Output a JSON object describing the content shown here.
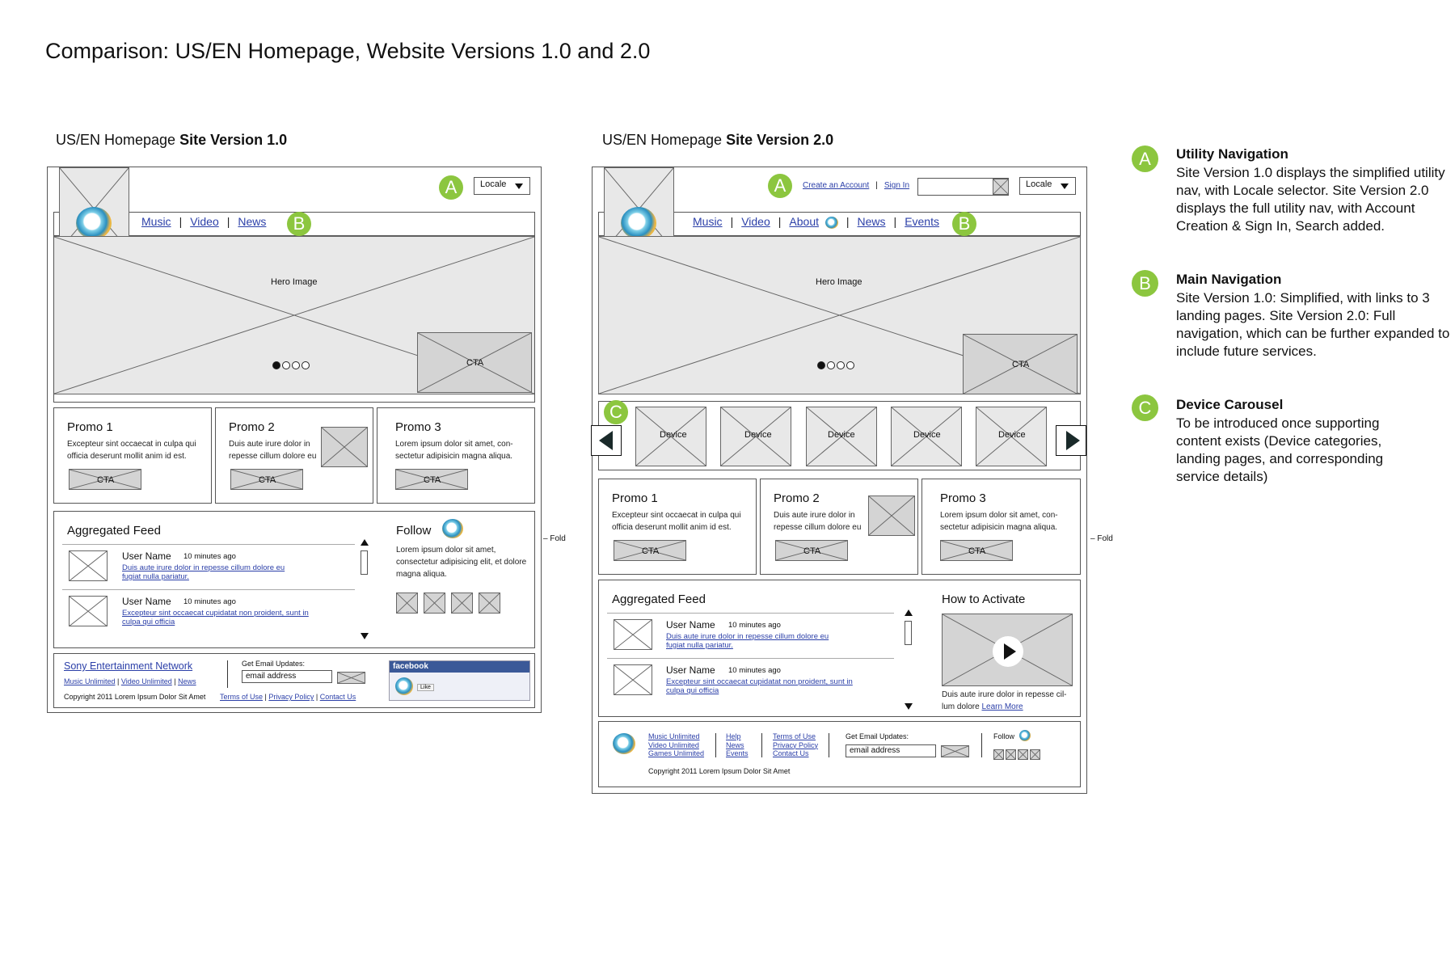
{
  "title": "Comparison: US/EN Homepage, Website Versions 1.0 and 2.0",
  "v1": {
    "label_prefix": "US/EN Homepage ",
    "label_bold": "Site Version 1.0",
    "locale": "Locale",
    "nav": [
      "Music",
      "Video",
      "News"
    ],
    "hero": "Hero Image",
    "cta": "CTA",
    "promos": [
      {
        "title": "Promo 1",
        "text": "Excepteur sint occaecat in culpa qui officia deserunt mollit anim id est."
      },
      {
        "title": "Promo 2",
        "text": "Duis aute irure dolor in repesse cillum dolore eu"
      },
      {
        "title": "Promo 3",
        "text": "Lorem ipsum dolor sit amet, con-sectetur adipisicin magna aliqua."
      }
    ],
    "feed_title": "Aggregated Feed",
    "feed_items": [
      {
        "user": "User Name",
        "time": "10 minutes ago",
        "text": "Duis aute irure dolor in repesse cillum dolore eu fugiat nulla pariatur."
      },
      {
        "user": "User Name",
        "time": "10 minutes ago",
        "text": "Excepteur sint occaecat cupidatat non proident, sunt in culpa qui officia"
      }
    ],
    "follow_title": "Follow",
    "follow_text": "Lorem ipsum dolor sit amet, consectetur adipisicing elit, et dolore magna aliqua.",
    "fold": "Fold",
    "footer": {
      "brand": "Sony Entertainment Network",
      "links": [
        "Music Unlimited",
        "Video Unlimited",
        "News"
      ],
      "copyright": "Copyright 2011 Lorem Ipsum Dolor Sit Amet",
      "legal": [
        "Terms of Use",
        "Privacy Policy",
        "Contact Us"
      ],
      "email_label": "Get Email Updates:",
      "email_placeholder": "email address",
      "facebook": "facebook",
      "like": "Like"
    }
  },
  "v2": {
    "label_prefix": "US/EN Homepage ",
    "label_bold": "Site Version 2.0",
    "create_account": "Create an Account",
    "sign_in": "Sign In",
    "locale": "Locale",
    "nav": [
      "Music",
      "Video",
      "About",
      "News",
      "Events"
    ],
    "hero": "Hero Image",
    "cta": "CTA",
    "devices": [
      "Device",
      "Device",
      "Device",
      "Device",
      "Device"
    ],
    "promos": [
      {
        "title": "Promo 1",
        "text": "Excepteur sint occaecat in culpa qui officia deserunt mollit anim id est."
      },
      {
        "title": "Promo 2",
        "text": "Duis aute irure dolor in repesse cillum dolore eu"
      },
      {
        "title": "Promo 3",
        "text": "Lorem ipsum dolor sit amet, con-sectetur adipisicin magna aliqua."
      }
    ],
    "feed_title": "Aggregated Feed",
    "feed_items": [
      {
        "user": "User Name",
        "time": "10 minutes ago",
        "text": "Duis aute irure dolor in repesse cillum dolore eu fugiat nulla pariatur."
      },
      {
        "user": "User Name",
        "time": "10 minutes ago",
        "text": "Excepteur sint occaecat cupidatat non proident, sunt in culpa qui officia"
      }
    ],
    "activate_title": "How to Activate",
    "activate_text": "Duis aute irure dolor in repesse cil-lum dolore",
    "learn_more": "Learn More",
    "fold": "Fold",
    "footer": {
      "col1": [
        "Music Unlimited",
        "Video Unlimited",
        "Games Unlimited"
      ],
      "col2": [
        "Help",
        "News",
        "Events"
      ],
      "col3": [
        "Terms of Use",
        "Privacy Policy",
        "Contact Us"
      ],
      "email_label": "Get Email Updates:",
      "email_placeholder": "email address",
      "follow": "Follow",
      "copyright": "Copyright 2011 Lorem Ipsum Dolor Sit Amet"
    }
  },
  "notes": [
    {
      "badge": "A",
      "title": "Utility Navigation",
      "body": "Site Version 1.0 displays the simplified utility nav, with Locale selector. Site Version 2.0 displays the full utility nav, with Account Creation & Sign In, Search added."
    },
    {
      "badge": "B",
      "title": "Main Navigation",
      "body": "Site Version 1.0: Simplified, with links to 3 landing pages. Site Version 2.0: Full navigation, which can be further expanded to include future services."
    },
    {
      "badge": "C",
      "title": "Device Carousel",
      "body": "To be introduced once supporting content exists (Device categories, landing pages, and corresponding service details)"
    }
  ],
  "colors": {
    "badge": "#8cc63f",
    "link": "#2b3fa8"
  }
}
